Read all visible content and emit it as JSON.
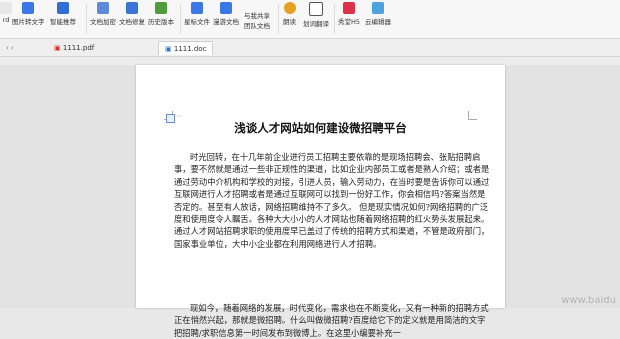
{
  "ribbon": {
    "items": [
      {
        "label": "rd",
        "icon": "file-icon",
        "color": "#777777"
      },
      {
        "label": "图片转文字",
        "icon": "picture-text-icon",
        "color": "#3b78e7"
      },
      {
        "label": "智能推荐",
        "icon": "smart-recommend-icon",
        "color": "#2f6fd6"
      },
      {
        "label": "文档加密",
        "icon": "lock-icon",
        "color": "#5a8ad8"
      },
      {
        "label": "文档修复",
        "icon": "repair-icon",
        "color": "#3a72d5"
      },
      {
        "label": "历史版本",
        "icon": "history-icon",
        "color": "#4f9d3a"
      },
      {
        "label": "星标文件",
        "icon": "star-file-icon",
        "color": "#3b78e7"
      },
      {
        "label": "漫游文档",
        "icon": "roam-icon",
        "color": "#3b78e7"
      },
      {
        "label": "团队文档",
        "icon": "team-doc-icon",
        "color": "#3b78e7"
      },
      {
        "label": "朗读",
        "icon": "read-aloud-icon",
        "color": "#e8a020"
      },
      {
        "label": "划词翻译",
        "icon": "translate-icon",
        "color": "#555555"
      },
      {
        "label": "秀堂H5",
        "icon": "h5-icon",
        "color": "#e0304b"
      },
      {
        "label": "云编辑器",
        "icon": "cloud-editor-icon",
        "color": "#4aa3df"
      }
    ],
    "share_label": "与我共享"
  },
  "tabs": [
    {
      "label": "1111.pdf",
      "icon": "pdf-icon"
    },
    {
      "label": "1111.doc",
      "icon": "doc-icon"
    }
  ],
  "doc": {
    "title": "浅谈人才网站如何建设微招聘平台",
    "para1": "时光回转，在十几年前企业进行员工招聘主要依靠的是现场招聘会、张贴招聘启事，要不然就是通过一些非正规性的渠道，比如企业内部员工或者是熟人介绍；或者是通过劳动中介机构和学校的对接，引进人员，输入劳动力，在当时要是告诉你可以通过互联网进行人才招聘或者是通过互联网可以找到一份好工作，你会相信吗?答案当然是否定的。甚至有人放话，网络招聘维持不了多久。 但是现实情况如何?网络招聘的广泛度和使用度令人瞩舌。各种大大小小的人才网站也随着网络招聘的红火势头发展起来。通过人才网站招聘求职的使用度早已盖过了传统的招聘方式和渠道，不管是政府部门，国家事业单位，大中小企业都在利用网络进行人才招聘。",
    "para2": "现如今，随着网络的发展，时代变化，需求也在不断变化，又有一种新的招聘方式正在悄然兴起，那就是微招聘。什么叫做微招聘?百度给它下的定义就是用简洁的文字把招聘/求职信息第一时间发布到微博上。在这里小编要补充一",
    "watermark": "www.baidu"
  }
}
